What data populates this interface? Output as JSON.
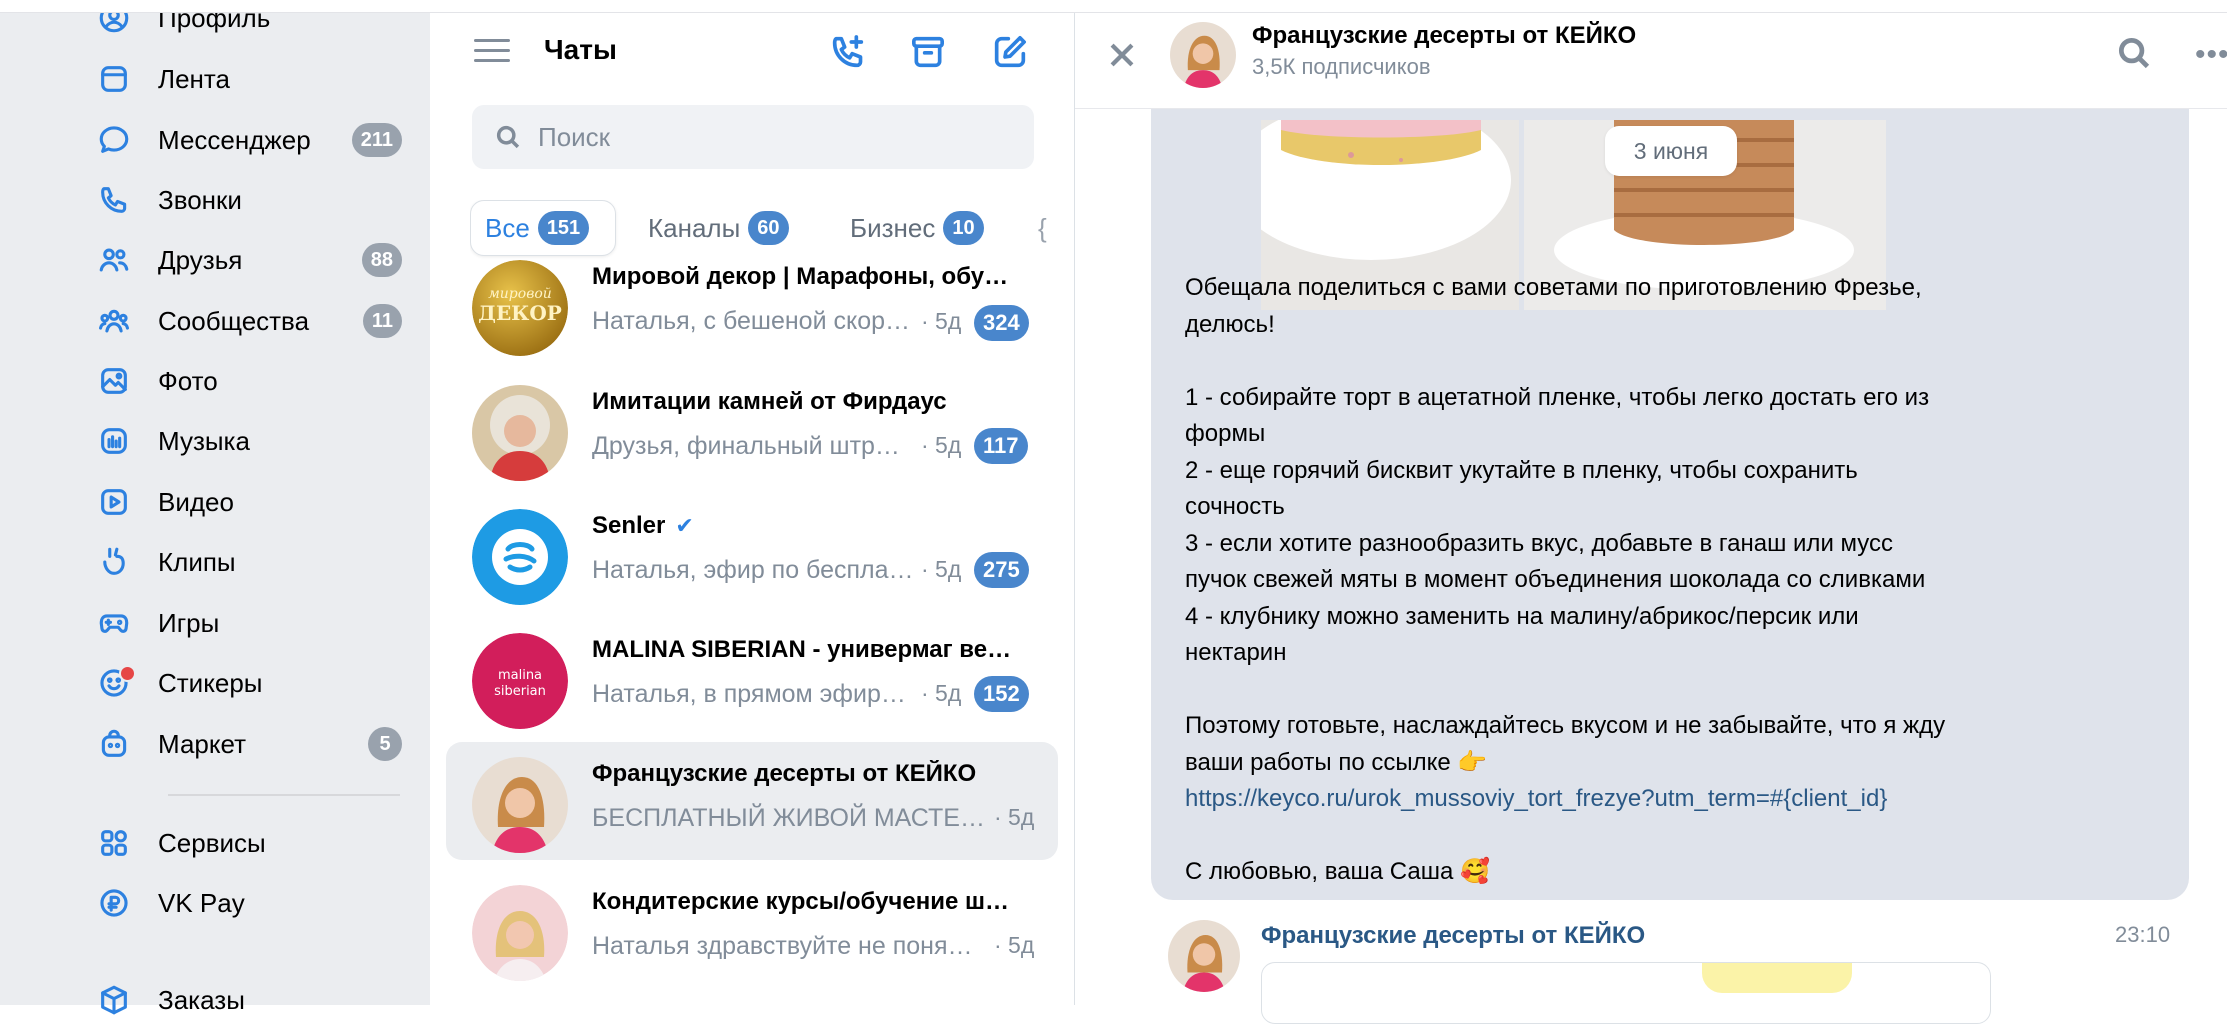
{
  "nav": {
    "items": [
      {
        "label": "Профиль",
        "icon": "profile-icon",
        "badge": ""
      },
      {
        "label": "Лента",
        "icon": "feed-icon",
        "badge": ""
      },
      {
        "label": "Мессенджер",
        "icon": "messenger-icon",
        "badge": "211"
      },
      {
        "label": "Звонки",
        "icon": "phone-icon",
        "badge": ""
      },
      {
        "label": "Друзья",
        "icon": "friends-icon",
        "badge": "88"
      },
      {
        "label": "Сообщества",
        "icon": "communities-icon",
        "badge": "11"
      },
      {
        "label": "Фото",
        "icon": "photo-icon",
        "badge": ""
      },
      {
        "label": "Музыка",
        "icon": "music-icon",
        "badge": ""
      },
      {
        "label": "Видео",
        "icon": "video-icon",
        "badge": ""
      },
      {
        "label": "Клипы",
        "icon": "clips-icon",
        "badge": ""
      },
      {
        "label": "Игры",
        "icon": "games-icon",
        "badge": ""
      },
      {
        "label": "Стикеры",
        "icon": "stickers-icon",
        "badge": ""
      },
      {
        "label": "Маркет",
        "icon": "market-icon",
        "badge": "5"
      },
      {
        "label": "Сервисы",
        "icon": "services-icon",
        "badge": ""
      },
      {
        "label": "VK Pay",
        "icon": "vkpay-icon",
        "badge": ""
      },
      {
        "label": "Заказы",
        "icon": "orders-icon",
        "badge": ""
      }
    ]
  },
  "chatlist": {
    "title": "Чаты",
    "search_placeholder": "Поиск",
    "tabs": [
      {
        "label": "Все",
        "count": "151"
      },
      {
        "label": "Каналы",
        "count": "60"
      },
      {
        "label": "Бизнес",
        "count": "10"
      }
    ],
    "chats": [
      {
        "name": "Мировой декор | Марафоны, обу…",
        "preview": "Наталья, с бешеной скор…",
        "time": "· 5д",
        "badge": "324"
      },
      {
        "name": "Имитации камней от Фирдаус",
        "preview": "Друзья, финальный штр…",
        "time": "· 5д",
        "badge": "117"
      },
      {
        "name": "Senler",
        "preview": "Наталья, эфир по беспла…",
        "time": "· 5д",
        "badge": "275"
      },
      {
        "name": "MALINA SIBERIAN - универмаг ве…",
        "preview": "Наталья, в прямом эфир…",
        "time": "· 5д",
        "badge": "152"
      },
      {
        "name": "Французские десерты от КЕЙКО",
        "preview": "БЕСПЛАТНЫЙ ЖИВОЙ МАСТЕ…",
        "time": "· 5д",
        "badge": ""
      },
      {
        "name": "Кондитерские курсы/обучение ш…",
        "preview": "Наталья здравствуйте не поня…",
        "time": "· 5д",
        "badge": ""
      }
    ],
    "avatar_texts": {
      "mirovoy": "мировой ДЕКОР",
      "malina": "malina siberian"
    }
  },
  "conversation": {
    "title": "Французские десерты от КЕЙКО",
    "subtitle": "3,5К подписчиков",
    "date_pill": "3 июня",
    "post_lines": [
      "Обещала поделиться с вами советами по приготовлению Фрезье,",
      "делюсь!",
      "",
      "1 - собирайте торт в ацетатной пленке, чтобы легко достать его из",
      "формы",
      "2 - еще горячий бисквит укутайте в пленку, чтобы сохранить",
      "сочность",
      "3 - если хотите разнообразить вкус, добавьте в ганаш или мусс",
      "пучок свежей мяты в момент объединения шоколада со сливками",
      "4 - клубнику можно заменить на малину/абрикос/персик или",
      "нектарин",
      "",
      "Поэтому готовьте, наслаждайтесь вкусом и не забывайте, что я жду",
      "ваши работы по ссылке 👉"
    ],
    "link": "https://keyco.ru/urok_mussoviy_tort_frezye?utm_term=#{client_id}",
    "signoff": "С любовью, ваша Саша 🥰",
    "next_message": {
      "author": "Французские десерты от КЕЙКО",
      "time": "23:10"
    }
  },
  "colors": {
    "accent": "#2d81e0",
    "badge_blue": "#4986cc",
    "badge_gray": "#99a2ad",
    "bubble": "#dfe3eb",
    "nav_bg": "#ebedf0"
  }
}
